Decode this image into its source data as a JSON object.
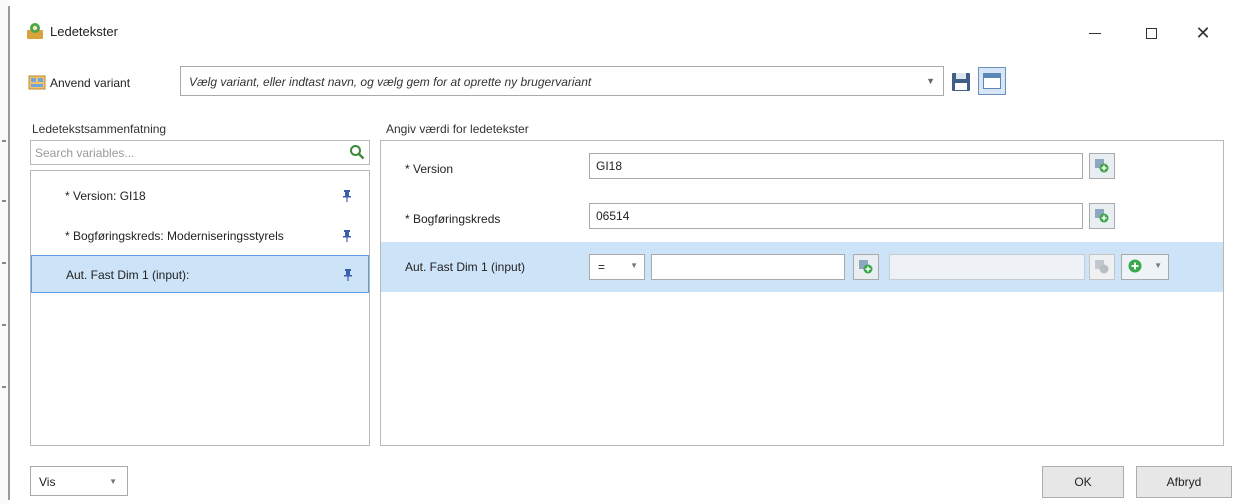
{
  "window": {
    "title": "Ledetekster"
  },
  "variant": {
    "label": "Anvend variant",
    "placeholder": "Vælg variant, eller indtast navn, og vælg gem for at oprette ny brugervariant"
  },
  "summary": {
    "header": "Ledetekstsammenfatning",
    "search_placeholder": "Search variables...",
    "items": [
      {
        "label": "* Version: GI18"
      },
      {
        "label": "* Bogføringskreds: Moderniseringsstyrels"
      },
      {
        "label": "Aut. Fast Dim 1 (input):",
        "selected": true
      }
    ]
  },
  "prompts": {
    "header": "Angiv værdi for ledetekster",
    "rows": [
      {
        "label": "* Version",
        "value": "GI18"
      },
      {
        "label": "* Bogføringskreds",
        "value": "06514"
      },
      {
        "label": "Aut. Fast Dim 1 (input)",
        "operator": "=",
        "value": "",
        "value_to": ""
      }
    ]
  },
  "footer": {
    "vis_label": "Vis",
    "ok_label": "OK",
    "cancel_label": "Afbryd"
  },
  "colors": {
    "selection": "#cde3f7",
    "selection_border": "#5c9ce0",
    "accent_green": "#3aa84a"
  }
}
